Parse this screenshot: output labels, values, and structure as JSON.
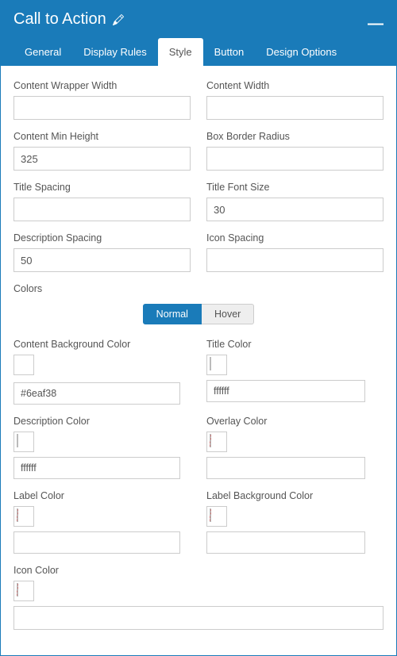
{
  "header": {
    "title": "Call to Action"
  },
  "tabs": {
    "general": "General",
    "display_rules": "Display Rules",
    "style": "Style",
    "button": "Button",
    "design_options": "Design Options"
  },
  "fields": {
    "content_wrapper_width": {
      "label": "Content Wrapper Width",
      "value": ""
    },
    "content_width": {
      "label": "Content Width",
      "value": ""
    },
    "content_min_height": {
      "label": "Content Min Height",
      "value": "325"
    },
    "box_border_radius": {
      "label": "Box Border Radius",
      "value": ""
    },
    "title_spacing": {
      "label": "Title Spacing",
      "value": ""
    },
    "title_font_size": {
      "label": "Title Font Size",
      "value": "30"
    },
    "description_spacing": {
      "label": "Description Spacing",
      "value": "50"
    },
    "icon_spacing": {
      "label": "Icon Spacing",
      "value": ""
    }
  },
  "colors_section": {
    "label": "Colors",
    "toggle": {
      "normal": "Normal",
      "hover": "Hover"
    },
    "content_bg": {
      "label": "Content Background Color",
      "value": "#6eaf38",
      "swatch": "#6eaf38"
    },
    "title_color": {
      "label": "Title Color",
      "value": "ffffff",
      "swatch": ""
    },
    "description_color": {
      "label": "Description Color",
      "value": "ffffff",
      "swatch": ""
    },
    "overlay_color": {
      "label": "Overlay Color",
      "value": "",
      "swatch": "none"
    },
    "label_color": {
      "label": "Label Color",
      "value": "",
      "swatch": "none"
    },
    "label_bg_color": {
      "label": "Label Background Color",
      "value": "",
      "swatch": "none"
    },
    "icon_color": {
      "label": "Icon Color",
      "value": "",
      "swatch": "none"
    }
  }
}
